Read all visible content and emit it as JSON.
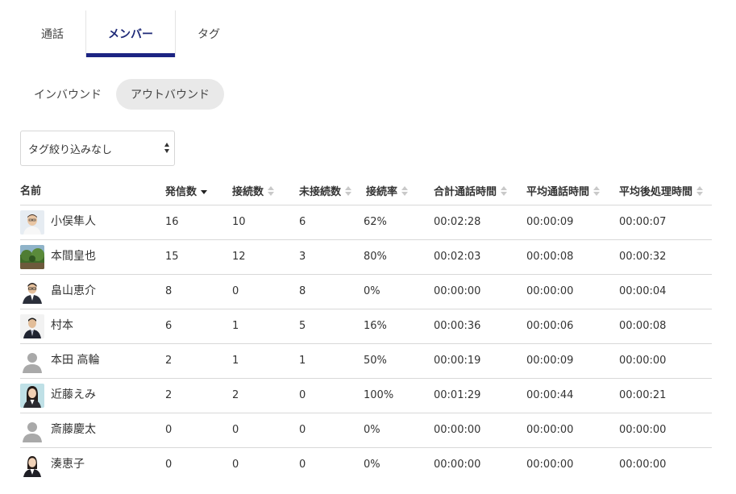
{
  "tabs": [
    {
      "label": "通話"
    },
    {
      "label": "メンバー"
    },
    {
      "label": "タグ"
    }
  ],
  "direction": [
    {
      "label": "インバウンド"
    },
    {
      "label": "アウトバウンド"
    }
  ],
  "tag_filter": {
    "selected": "タグ絞り込みなし"
  },
  "table": {
    "headers": {
      "name": "名前",
      "outgoing": "発信数",
      "connected": "接続数",
      "unconnected": "未接続数",
      "rate": "接続率",
      "total_time": "合計通話時間",
      "avg_time": "平均通話時間",
      "avg_post": "平均後処理時間"
    },
    "rows": [
      {
        "name": "小俣隼人",
        "outgoing": "16",
        "connected": "10",
        "unconnected": "6",
        "rate": "62%",
        "total": "00:02:28",
        "avg": "00:00:09",
        "post": "00:00:07",
        "avatar": "photo-man-white-shirt"
      },
      {
        "name": "本間皇也",
        "outgoing": "15",
        "connected": "12",
        "unconnected": "3",
        "rate": "80%",
        "total": "00:02:03",
        "avg": "00:00:08",
        "post": "00:00:32",
        "avatar": "photo-landscape"
      },
      {
        "name": "畠山恵介",
        "outgoing": "8",
        "connected": "0",
        "unconnected": "8",
        "rate": "0%",
        "total": "00:00:00",
        "avg": "00:00:00",
        "post": "00:00:04",
        "avatar": "photo-man-suit-glasses"
      },
      {
        "name": "村本",
        "outgoing": "6",
        "connected": "1",
        "unconnected": "5",
        "rate": "16%",
        "total": "00:00:36",
        "avg": "00:00:06",
        "post": "00:00:08",
        "avatar": "photo-man-suit"
      },
      {
        "name": "本田 高輪",
        "outgoing": "2",
        "connected": "1",
        "unconnected": "1",
        "rate": "50%",
        "total": "00:00:19",
        "avg": "00:00:09",
        "post": "00:00:00",
        "avatar": "default-user"
      },
      {
        "name": "近藤えみ",
        "outgoing": "2",
        "connected": "2",
        "unconnected": "0",
        "rate": "100%",
        "total": "00:01:29",
        "avg": "00:00:44",
        "post": "00:00:21",
        "avatar": "photo-woman"
      },
      {
        "name": "斎藤慶太",
        "outgoing": "0",
        "connected": "0",
        "unconnected": "0",
        "rate": "0%",
        "total": "00:00:00",
        "avg": "00:00:00",
        "post": "00:00:00",
        "avatar": "default-user"
      },
      {
        "name": "湊恵子",
        "outgoing": "0",
        "connected": "0",
        "unconnected": "0",
        "rate": "0%",
        "total": "00:00:00",
        "avg": "00:00:00",
        "post": "00:00:00",
        "avatar": "photo-woman-suit"
      }
    ]
  },
  "colors": {
    "accent": "#1c2483",
    "active_pill": "#e9e9e9",
    "divider": "#d8d8d8"
  }
}
